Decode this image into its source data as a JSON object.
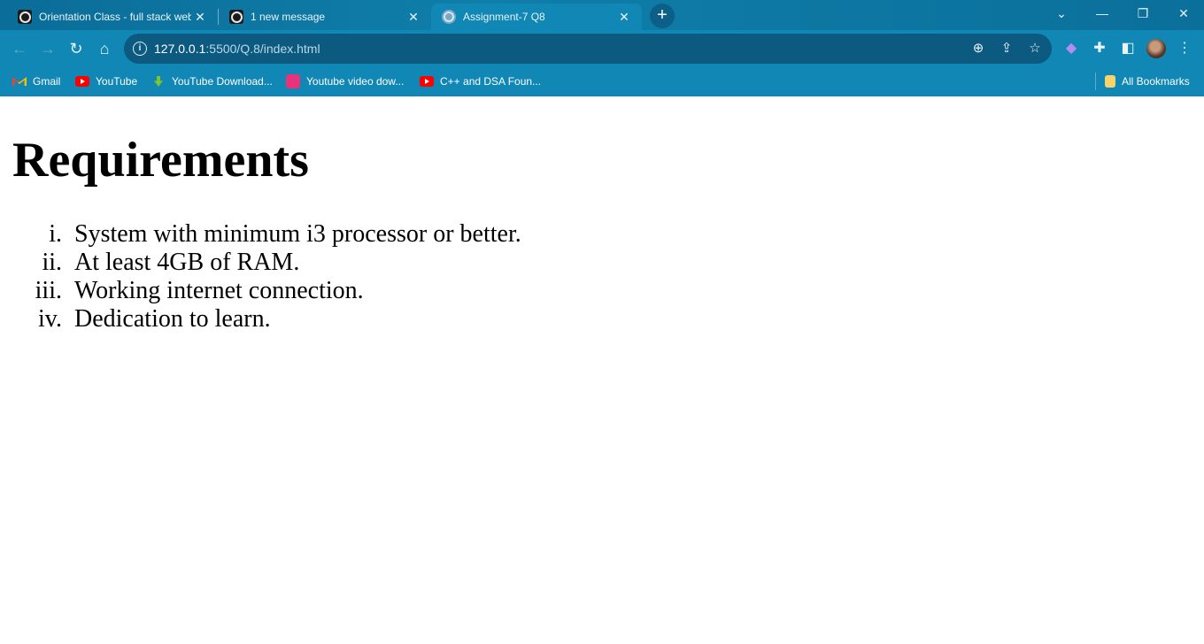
{
  "browser": {
    "tabs": [
      {
        "title": "Orientation Class - full stack web",
        "favicon": "class-favicon-icon",
        "active": false
      },
      {
        "title": "1 new message",
        "favicon": "message-favicon-icon",
        "active": false
      },
      {
        "title": "Assignment-7 Q8",
        "favicon": "globe-icon",
        "active": true
      }
    ],
    "new_tab": "+",
    "window_controls": {
      "dropdown": "⌄",
      "minimize": "—",
      "restore": "❐",
      "close": "✕"
    },
    "address": {
      "host": "127.0.0.1",
      "rest": ":5500/Q.8/index.html"
    },
    "bookmarks": [
      {
        "label": "Gmail",
        "icon": "gmail-icon"
      },
      {
        "label": "YouTube",
        "icon": "youtube-icon"
      },
      {
        "label": "YouTube Download...",
        "icon": "download-icon"
      },
      {
        "label": "Youtube video dow...",
        "icon": "video-download-icon"
      },
      {
        "label": "C++ and DSA Foun...",
        "icon": "youtube-icon"
      }
    ],
    "all_bookmarks": "All Bookmarks",
    "colors": {
      "chrome": "#1087b4",
      "omnibox": "#0c5a7f",
      "youtube": "#ff0000"
    }
  },
  "page": {
    "heading": "Requirements",
    "items": [
      {
        "num": "i.",
        "text": "System with minimum i3 processor or better."
      },
      {
        "num": "ii.",
        "text": "At least 4GB of RAM."
      },
      {
        "num": "iii.",
        "text": "Working internet connection."
      },
      {
        "num": "iv.",
        "text": "Dedication to learn."
      }
    ]
  }
}
